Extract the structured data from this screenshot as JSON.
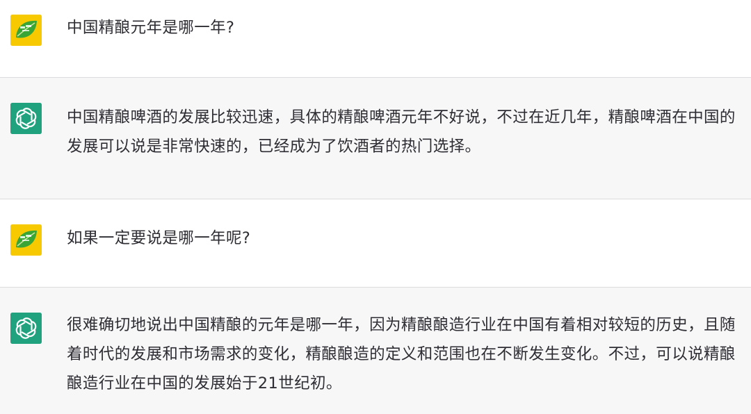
{
  "conversation": {
    "turns": [
      {
        "role": "user",
        "avatar_icon": "green-leaf-logo-icon",
        "text": "中国精酿元年是哪一年?"
      },
      {
        "role": "assistant",
        "avatar_icon": "openai-logo-icon",
        "text": "中国精酿啤酒的发展比较迅速，具体的精酿啤酒元年不好说，不过在近几年，精酿啤酒在中国的发展可以说是非常快速的，已经成为了饮酒者的热门选择。"
      },
      {
        "role": "user",
        "avatar_icon": "green-leaf-logo-icon",
        "text": "如果一定要说是哪一年呢?"
      },
      {
        "role": "assistant",
        "avatar_icon": "openai-logo-icon",
        "text": "很难确切地说出中国精酿的元年是哪一年，因为精酿酿造行业在中国有着相对较短的历史，且随着时代的发展和市场需求的变化，精酿酿造的定义和范围也在不断发生变化。不过，可以说精酿酿造行业在中国的发展始于21世纪初。"
      }
    ]
  },
  "colors": {
    "user_bg": "#ffffff",
    "assistant_bg": "#f7f7f8",
    "text": "#2d2d33",
    "bot_avatar": "#1fa27d",
    "user_avatar": "#f7c900"
  }
}
